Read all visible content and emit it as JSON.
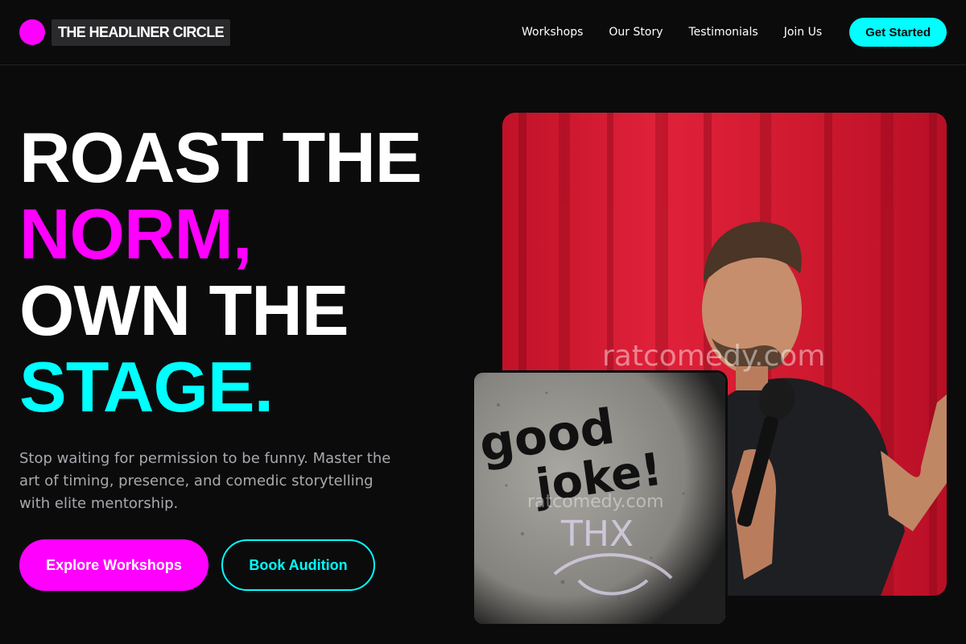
{
  "brand": {
    "name": "THE HEADLINER CIRCLE",
    "accent": "#ff00ff"
  },
  "nav": {
    "links": [
      "Workshops",
      "Our Story",
      "Testimonials",
      "Join Us"
    ],
    "cta": "Get Started"
  },
  "hero": {
    "line1": "ROAST THE",
    "line2": "NORM,",
    "line3": "OWN THE",
    "line4": "STAGE.",
    "subtitle": "Stop waiting for permission to be funny. Master the art of timing, presence, and comedic storytelling with elite mentorship.",
    "primary_button": "Explore Workshops",
    "secondary_button": "Book Audition"
  },
  "images": {
    "main_watermark": "ratcomedy.com",
    "inset_watermark": "ratcomedy.com",
    "graffiti_text_1": "good",
    "graffiti_text_2": "joke!",
    "graffiti_text_3": "THX"
  },
  "colors": {
    "magenta": "#ff00ff",
    "cyan": "#00ffff",
    "background": "#0b0b0c",
    "muted_text": "#a7a9ad"
  }
}
